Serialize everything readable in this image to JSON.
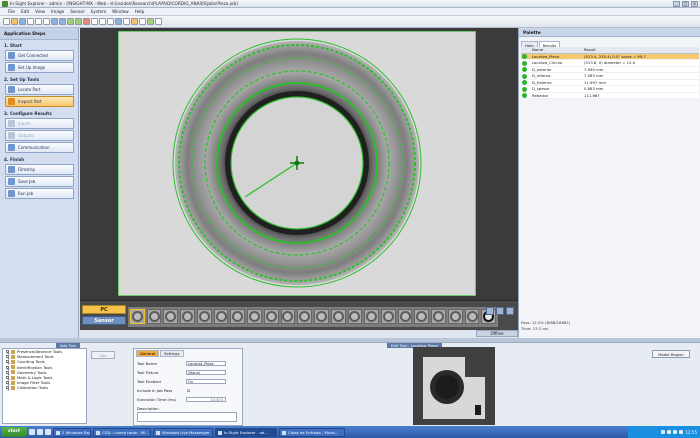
{
  "window": {
    "title": "In-Sight Explorer - admin - [INSIGHT-MX - Web - H:\\insidek\\Research\\PLAYA\\DICORDIO_ANAI\\IS\\Jobs\\Pieza.job]",
    "min": "_",
    "max": "□",
    "close": "×"
  },
  "menu": [
    "File",
    "Edit",
    "View",
    "Image",
    "Sensor",
    "System",
    "Window",
    "Help"
  ],
  "left": {
    "header": "Application Steps",
    "sections": [
      {
        "title": "1. Start",
        "items": [
          {
            "label": "Get Connected",
            "state": "normal"
          },
          {
            "label": "Set Up Image",
            "state": "normal"
          }
        ]
      },
      {
        "title": "2. Set Up Tools",
        "items": [
          {
            "label": "Locate Part",
            "state": "normal"
          },
          {
            "label": "Inspect Part",
            "state": "active"
          }
        ]
      },
      {
        "title": "3. Configure Results",
        "items": [
          {
            "label": "Inputs",
            "state": "disabled"
          },
          {
            "label": "Outputs",
            "state": "disabled"
          },
          {
            "label": "Communication",
            "state": "normal"
          }
        ]
      },
      {
        "title": "4. Finish",
        "items": [
          {
            "label": "Filmstrip",
            "state": "normal"
          },
          {
            "label": "Save Job",
            "state": "normal"
          },
          {
            "label": "Run Job",
            "state": "normal"
          }
        ]
      }
    ]
  },
  "filmstrip": {
    "pc_label": "PC",
    "sensor_label": "Sensor",
    "status": "Offline"
  },
  "palette": {
    "title": "Palette",
    "tabs": [
      "Help",
      "Results"
    ],
    "columns": [
      "",
      "Name",
      "Result"
    ],
    "rows": [
      {
        "name": "Localiza_Pieza",
        "result": "(513.4, 235.4) 0.0° score = 99.7",
        "highlight": true
      },
      {
        "name": "Localiza_Circulo",
        "result": "(513.8, 0) diameter = 12.0",
        "highlight": false
      },
      {
        "name": "D_exterior",
        "result": "7.990 mm",
        "highlight": false
      },
      {
        "name": "D_Interno",
        "result": "7.583 mm",
        "highlight": false
      },
      {
        "name": "D_Externo",
        "result": "11.997 mm",
        "highlight": false
      },
      {
        "name": "D_spesor",
        "result": "0.883 mm",
        "highlight": false
      },
      {
        "name": "Rebarba",
        "result": "111.667",
        "highlight": false
      }
    ],
    "stat1": "Pass: 12.5% (8/8B/16662)",
    "stat2": "Time: 23.3 ms"
  },
  "bottom": {
    "add_tool_title": "Add Tool",
    "tools": [
      "Presence/Absence Tools",
      "Measurement Tools",
      "Counting Tools",
      "Identification Tools",
      "Geometry Tools",
      "Math & Logic Tools",
      "Image Filter Tools",
      "Calibration Tools"
    ],
    "add_button": "Add",
    "props_tabs": [
      "General",
      "Settings"
    ],
    "props_header": "Edit Tool - Localiza_Pieza",
    "props": [
      {
        "label": "Tool Name",
        "value": "Localiza_Pieza"
      },
      {
        "label": "Tool Fixture",
        "value": "(None)"
      },
      {
        "label": "Tool Enabled",
        "value": "On"
      },
      {
        "label": "Include In Job Pass",
        "value": "☑"
      },
      {
        "label": "Execution Time (ms)",
        "value": "23.474"
      },
      {
        "label": "Description",
        "value": ""
      }
    ],
    "model_button": "Model Region"
  },
  "taskbar": {
    "start": "start",
    "tasks": [
      {
        "label": "2 Windows Explorer",
        "active": false
      },
      {
        "label": "CDD - nueva tarde - Mi...",
        "active": false
      },
      {
        "label": "Windows Live Messenger",
        "active": false
      },
      {
        "label": "In-Sight Explorer - ad...",
        "active": true
      },
      {
        "label": "Caixa de Entrada - Micro...",
        "active": false
      }
    ],
    "clock": "12:55"
  },
  "colors": {
    "overlay_green": "#2bbf2b",
    "highlight_row": "#f7c86e",
    "active_step": "#f7c76a"
  }
}
